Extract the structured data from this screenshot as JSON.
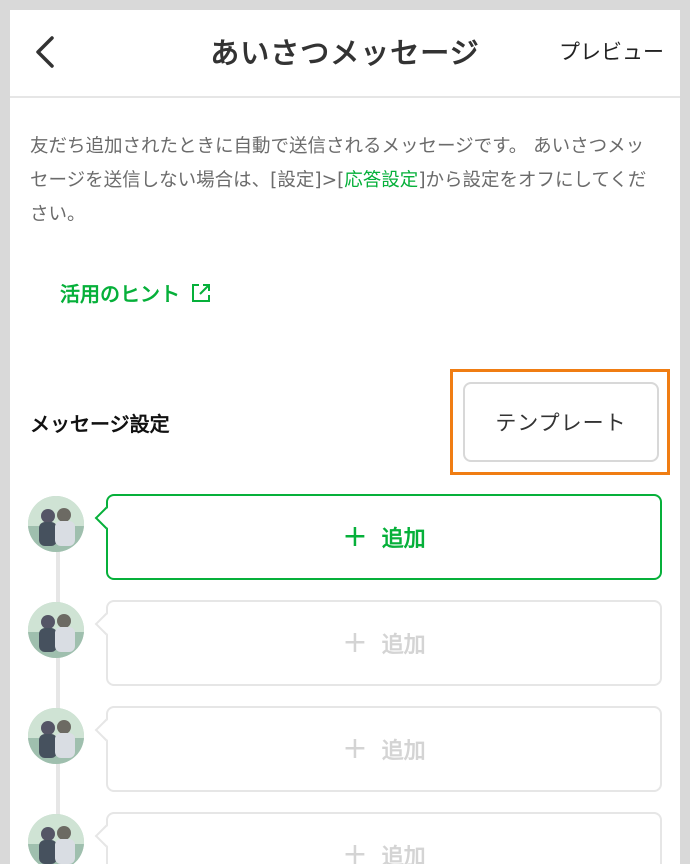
{
  "header": {
    "back_icon": "chevron-left-icon",
    "title": "あいさつメッセージ",
    "preview_label": "プレビュー"
  },
  "description": {
    "text_1": "友だち追加されたときに自動で送信されるメッセージです。 あいさつメッセージを送信しない場合は、[設定]>[",
    "link": "応答設定",
    "text_2": "]から設定をオフにしてください。"
  },
  "hint": {
    "label": "活用のヒント",
    "icon": "external-link-icon"
  },
  "message_settings": {
    "title": "メッセージ設定",
    "template_label": "テンプレート"
  },
  "messages": [
    {
      "plus": "+",
      "label": "追加",
      "state": "active"
    },
    {
      "plus": "+",
      "label": "追加",
      "state": "disabled"
    },
    {
      "plus": "+",
      "label": "追加",
      "state": "disabled"
    },
    {
      "plus": "+",
      "label": "追加",
      "state": "disabled"
    }
  ],
  "colors": {
    "accent_green": "#06b03a",
    "highlight_orange": "#f07d13",
    "disabled_gray": "#d4d4d4"
  }
}
